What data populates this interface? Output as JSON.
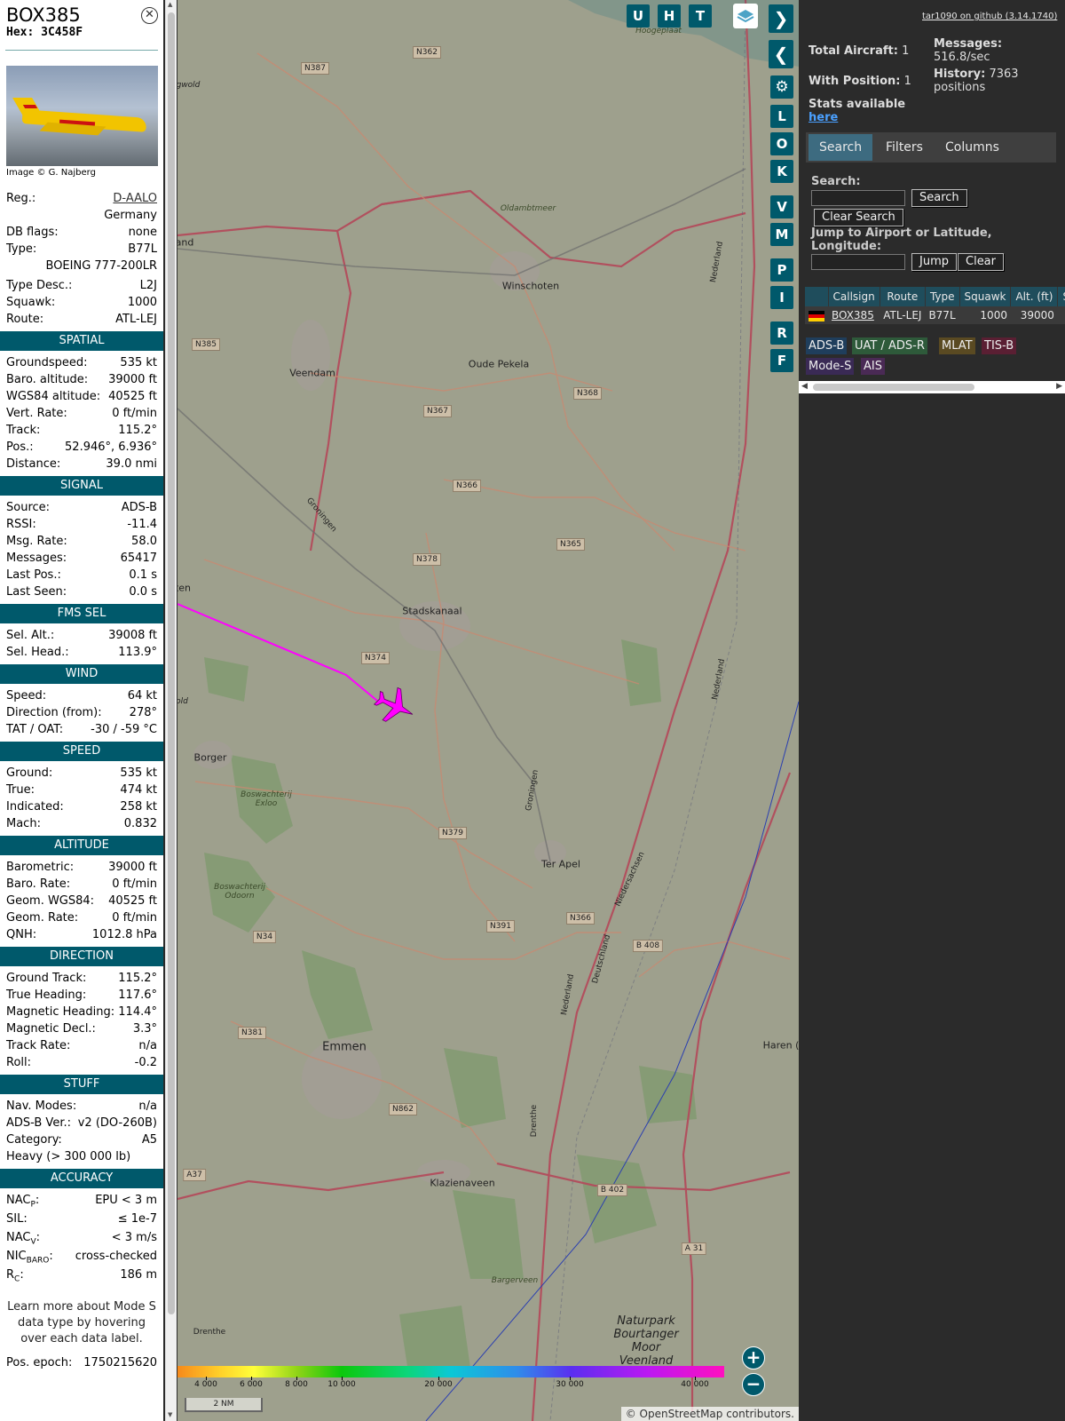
{
  "selected": {
    "callsign": "BOX385",
    "hex": "Hex: 3C458F",
    "photo_credit": "Image © G. Najberg",
    "top_rows": [
      {
        "label": "Reg.:",
        "value": "D-AALO",
        "link": true
      },
      {
        "label": "",
        "value": "Germany"
      },
      {
        "label": "DB flags:",
        "value": "none"
      },
      {
        "label": "Type:",
        "value": "B77L"
      },
      {
        "label": "",
        "value": "BOEING 777-200LR"
      }
    ],
    "mid_rows": [
      {
        "label": "Type Desc.:",
        "value": "L2J"
      },
      {
        "label": "Squawk:",
        "value": "1000"
      },
      {
        "label": "Route:",
        "value": "ATL-LEJ"
      }
    ],
    "sections": [
      {
        "title": "SPATIAL",
        "rows": [
          {
            "label": "Groundspeed:",
            "value": "535 kt"
          },
          {
            "label": "Baro. altitude:",
            "value": "39000 ft"
          },
          {
            "label": "WGS84 altitude:",
            "value": "40525 ft"
          },
          {
            "label": "Vert. Rate:",
            "value": "0 ft/min"
          },
          {
            "label": "Track:",
            "value": "115.2°"
          },
          {
            "label": "Pos.:",
            "value": "52.946°, 6.936°"
          },
          {
            "label": "Distance:",
            "value": "39.0 nmi"
          }
        ]
      },
      {
        "title": "SIGNAL",
        "rows": [
          {
            "label": "Source:",
            "value": "ADS-B"
          },
          {
            "label": "RSSI:",
            "value": "-11.4"
          },
          {
            "label": "Msg. Rate:",
            "value": "58.0"
          },
          {
            "label": "Messages:",
            "value": "65417"
          },
          {
            "label": "Last Pos.:",
            "value": "0.1 s"
          },
          {
            "label": "Last Seen:",
            "value": "0.0 s"
          }
        ]
      },
      {
        "title": "FMS SEL",
        "rows": [
          {
            "label": "Sel. Alt.:",
            "value": "39008 ft"
          },
          {
            "label": "Sel. Head.:",
            "value": "113.9°"
          }
        ]
      },
      {
        "title": "WIND",
        "rows": [
          {
            "label": "Speed:",
            "value": "64 kt"
          },
          {
            "label": "Direction (from):",
            "value": "278°"
          },
          {
            "label": "TAT / OAT:",
            "value": "-30 / -59 °C"
          }
        ]
      },
      {
        "title": "SPEED",
        "rows": [
          {
            "label": "Ground:",
            "value": "535 kt"
          },
          {
            "label": "True:",
            "value": "474 kt"
          },
          {
            "label": "Indicated:",
            "value": "258 kt"
          },
          {
            "label": "Mach:",
            "value": "0.832"
          }
        ]
      },
      {
        "title": "ALTITUDE",
        "rows": [
          {
            "label": "Barometric:",
            "value": "39000 ft"
          },
          {
            "label": "Baro. Rate:",
            "value": "0 ft/min"
          },
          {
            "label": "Geom. WGS84:",
            "value": "40525 ft"
          },
          {
            "label": "Geom. Rate:",
            "value": "0 ft/min"
          },
          {
            "label": "QNH:",
            "value": "1012.8 hPa"
          }
        ]
      },
      {
        "title": "DIRECTION",
        "rows": [
          {
            "label": "Ground Track:",
            "value": "115.2°"
          },
          {
            "label": "True Heading:",
            "value": "117.6°"
          },
          {
            "label": "Magnetic Heading:",
            "value": "114.4°"
          },
          {
            "label": "Magnetic Decl.:",
            "value": "3.3°"
          },
          {
            "label": "Track Rate:",
            "value": "n/a"
          },
          {
            "label": "Roll:",
            "value": "-0.2"
          }
        ]
      },
      {
        "title": "STUFF",
        "rows": [
          {
            "label": "Nav. Modes:",
            "value": "n/a"
          },
          {
            "label": "ADS-B Ver.:",
            "value": "v2 (DO-260B)"
          },
          {
            "label": "Category:",
            "value": "A5"
          },
          {
            "label": "Heavy (> 300 000 lb)",
            "value": ""
          }
        ]
      },
      {
        "title": "ACCURACY",
        "rows": [
          {
            "label": "NACP:",
            "value": "EPU < 3 m"
          },
          {
            "label": "SIL:",
            "value": "≤ 1e-7"
          },
          {
            "label": "NACV:",
            "value": "< 3 m/s"
          },
          {
            "label": "NICBARO:",
            "value": "cross-checked"
          },
          {
            "label": "RC:",
            "value": "186 m"
          }
        ]
      }
    ],
    "note": "Learn more about Mode S data type by hovering over each data label.",
    "epoch_label": "Pos. epoch:",
    "epoch_value": "1750215620"
  },
  "map": {
    "places": [
      "Winschoten",
      "Veendam",
      "Oude Pekela",
      "Stadskanaal",
      "Borger",
      "Ter Apel",
      "Emmen",
      "Klazienaveen",
      "Haren (",
      "Oldambtmeer",
      "Hoogeplaat",
      "Boswachterij Exloo",
      "Boswachterij Odoorn",
      "Bargerveen",
      "Naturpark Bourtanger Moor Veenland",
      "Drenthe",
      "Nederland",
      "Niedersachsen",
      "Deutschland",
      "Groningen",
      "gwold",
      "and",
      "ten",
      "old"
    ],
    "roads": [
      "N387",
      "N362",
      "N385",
      "N368",
      "N367",
      "N366",
      "N378",
      "N365",
      "N374",
      "N379",
      "N366",
      "N391",
      "N34",
      "B 408",
      "N381",
      "N862",
      "A37",
      "B 402",
      "A 31"
    ],
    "toolbar": [
      "U",
      "H",
      "T"
    ],
    "side_buttons": [
      "L",
      "O",
      "K",
      "V",
      "M",
      "P",
      "I",
      "R",
      "F"
    ],
    "altitude_legend": [
      "4 000",
      "6 000",
      "8 000",
      "10 000",
      "20 000",
      "30 000",
      "40 000"
    ],
    "scale": "2 NM",
    "attribution": "© OpenStreetMap contributors.",
    "aircraft_color": "#ff00ff",
    "track_color": "#ff00ff"
  },
  "stats": {
    "github": "tar1090 on github (3.14.1740)",
    "total_label": "Total Aircraft:",
    "total_value": "1",
    "messages_label": "Messages:",
    "messages_value": "516.8/sec",
    "position_label": "With Position:",
    "position_value": "1",
    "history_label": "History:",
    "history_value": "7363 positions",
    "stats_label": "Stats available",
    "stats_link": "here"
  },
  "tabs": [
    "Search",
    "Filters",
    "Columns"
  ],
  "search": {
    "label": "Search:",
    "search_button": "Search",
    "clear_button": "Clear Search",
    "jump_label": "Jump to Airport or Latitude, Longitude:",
    "jump_button": "Jump",
    "clear2_button": "Clear"
  },
  "table": {
    "headers": [
      "",
      "Callsign",
      "Route",
      "Type",
      "Squawk",
      "Alt. (ft)",
      "Spe"
    ],
    "row": {
      "callsign": "BOX385",
      "route": "ATL-LEJ",
      "type": "B77L",
      "squawk": "1000",
      "alt": "39000"
    }
  },
  "badges": [
    {
      "label": "ADS-B",
      "color": "#1f3e5c"
    },
    {
      "label": "UAT / ADS-R",
      "color": "#2e5a3a"
    },
    {
      "label": "MLAT",
      "color": "#5a4a22"
    },
    {
      "label": "TIS-B",
      "color": "#5a1f33"
    },
    {
      "label": "Mode-S",
      "color": "#3a2a55"
    },
    {
      "label": "AIS",
      "color": "#4a2a55"
    }
  ]
}
